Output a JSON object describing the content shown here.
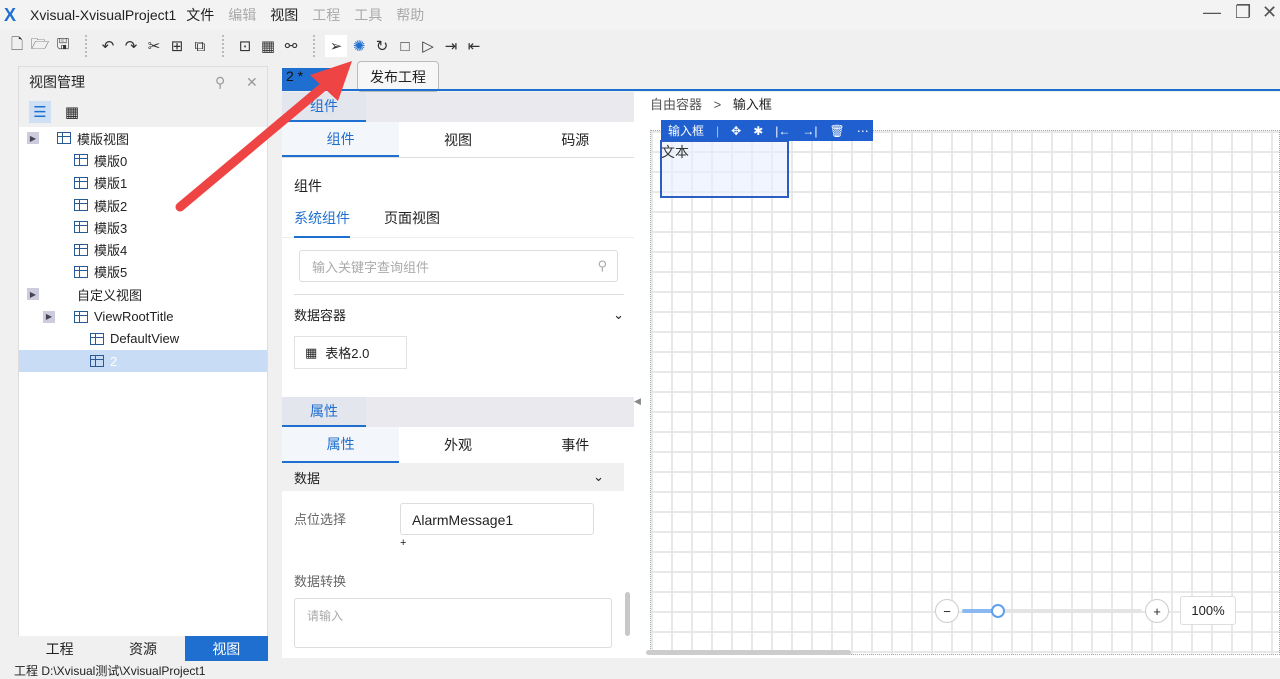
{
  "title": "Xvisual-XvisualProject1",
  "menu": [
    "文件",
    "编辑",
    "视图",
    "工程",
    "工具",
    "帮助"
  ],
  "tooltip": "发布工程",
  "left_panel": {
    "title": "视图管理",
    "tree": [
      {
        "label": "模版视图",
        "level": 0,
        "expand": true
      },
      {
        "label": "模版0",
        "level": 1
      },
      {
        "label": "模版1",
        "level": 1
      },
      {
        "label": "模版2",
        "level": 1
      },
      {
        "label": "模版3",
        "level": 1
      },
      {
        "label": "模版4",
        "level": 1
      },
      {
        "label": "模版5",
        "level": 1
      },
      {
        "label": "自定义视图",
        "level": 0,
        "expand": true
      },
      {
        "label": "ViewRootTitle",
        "level": 1,
        "expand": true
      },
      {
        "label": "DefaultView",
        "level": 2
      },
      {
        "label": "2",
        "level": 2,
        "selected": true
      }
    ],
    "bottom_tabs": [
      "工程",
      "资源",
      "视图"
    ]
  },
  "doc_tab": "2 *",
  "components": {
    "header": "组件",
    "tabs": [
      "组件",
      "视图",
      "码源"
    ],
    "section": "组件",
    "subtabs": [
      "系统组件",
      "页面视图"
    ],
    "search_placeholder": "输入关键字查询组件",
    "group": "数据容器",
    "item": "表格2.0"
  },
  "properties": {
    "header": "属性",
    "tabs": [
      "属性",
      "外观",
      "事件"
    ],
    "group": "数据",
    "point_label": "点位选择",
    "point_value": "AlarmMessage1",
    "plus": "+",
    "convert_label": "数据转换",
    "convert_placeholder": "请输入"
  },
  "canvas": {
    "breadcrumb": [
      "自由容器",
      "输入框"
    ],
    "sep": ">",
    "selected": "输入框",
    "widget_text": "文本",
    "zoom": "100%",
    "zoom_minus": "−",
    "zoom_plus": "+"
  },
  "status": "工程 D:\\Xvisual测试\\XvisualProject1"
}
